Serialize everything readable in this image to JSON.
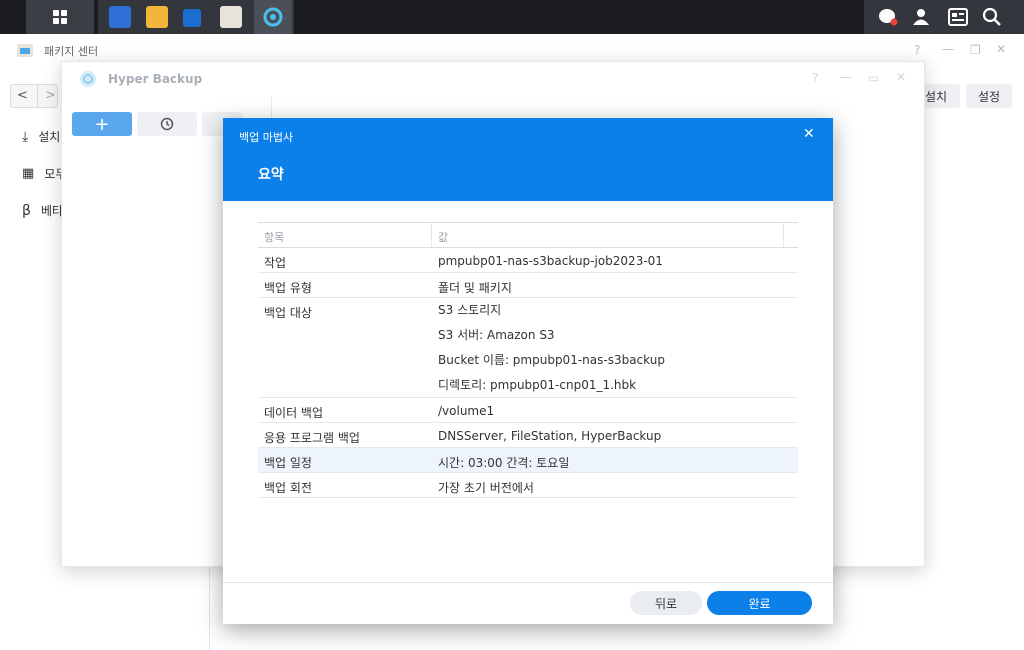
{
  "taskbar": {
    "icons": [
      "main-menu-icon",
      "file-station-icon",
      "folder-icon",
      "drive-icon",
      "package-center-icon",
      "hyper-backup-icon",
      "chat-icon",
      "user-icon",
      "widget-icon",
      "search-icon"
    ]
  },
  "package_center": {
    "title": "패키지 센터",
    "sidebar": [
      {
        "label": "설치",
        "icon": "download-icon"
      },
      {
        "label": "모두",
        "icon": "grid-icon"
      },
      {
        "label": "베타",
        "icon": "beta-icon"
      }
    ],
    "install_button": "설치",
    "settings_button": "설정"
  },
  "hyper_backup": {
    "title": "Hyper Backup",
    "add_button": "+"
  },
  "wizard": {
    "title": "백업 마법사",
    "close": "✕",
    "subtitle": "요약",
    "columns": {
      "item": "항목",
      "value": "값"
    },
    "rows": [
      {
        "key": "작업",
        "values": [
          "pmpubp01-nas-s3backup-job2023-01"
        ]
      },
      {
        "key": "백업 유형",
        "values": [
          "폴더 및 패키지"
        ]
      },
      {
        "key": "백업 대상",
        "values": [
          "S3 스토리지",
          "S3 서버: Amazon S3",
          "Bucket 이름: pmpubp01-nas-s3backup",
          "디렉토리: pmpubp01-cnp01_1.hbk"
        ]
      },
      {
        "key": "데이터 백업",
        "values": [
          "/volume1"
        ]
      },
      {
        "key": "응용 프로그램 백업",
        "values": [
          "DNSServer, FileStation, HyperBackup"
        ]
      },
      {
        "key": "백업 일정",
        "values": [
          "시간: 03:00 간격: 토요일"
        ],
        "highlight": true
      },
      {
        "key": "백업 회전",
        "values": [
          "가장 초기 버전에서"
        ]
      }
    ],
    "back_button": "뒤로",
    "done_button": "완료"
  },
  "colors": {
    "accent": "#0b80e8",
    "taskbar": "#1b1d22"
  }
}
